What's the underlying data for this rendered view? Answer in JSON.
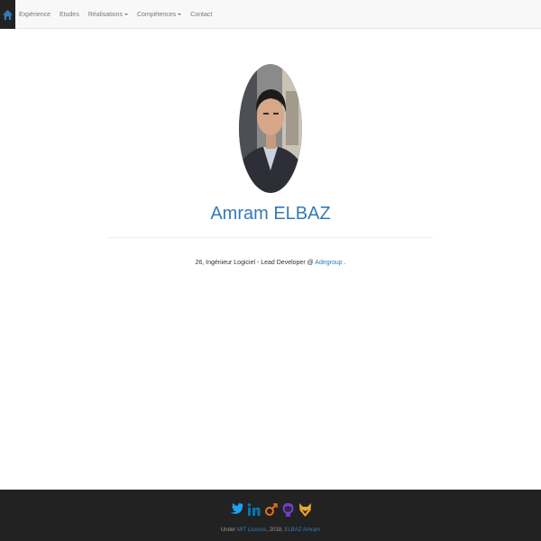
{
  "nav": {
    "home_icon": "home-icon",
    "items": [
      {
        "label": "Expérience"
      },
      {
        "label": "Etudes"
      },
      {
        "label": "Réalisations"
      },
      {
        "label": "Compétences"
      },
      {
        "label": "Contact"
      }
    ]
  },
  "profile": {
    "name": "Amram ELBAZ",
    "tagline_prefix": "26, Ingénieur Logiciel - Lead Developer @ ",
    "company": "Adegroup",
    "tagline_suffix": " ."
  },
  "footer": {
    "icons": [
      "twitter-icon",
      "linkedin-icon",
      "gender-icon",
      "github-icon",
      "fox-icon"
    ],
    "text_prefix": "Under ",
    "license": "MIT Licence",
    "text_middle": ", 2018, ",
    "author": "ELBAZ Amram"
  },
  "colors": {
    "navbar_bg": "#f8f8f8",
    "link": "#337ab7",
    "footer_bg": "#222222",
    "twitter": "#1da1f2",
    "linkedin": "#0077b5",
    "gender": "#e7711b",
    "github": "#6e3fc9",
    "fox": "#e8a72f"
  }
}
